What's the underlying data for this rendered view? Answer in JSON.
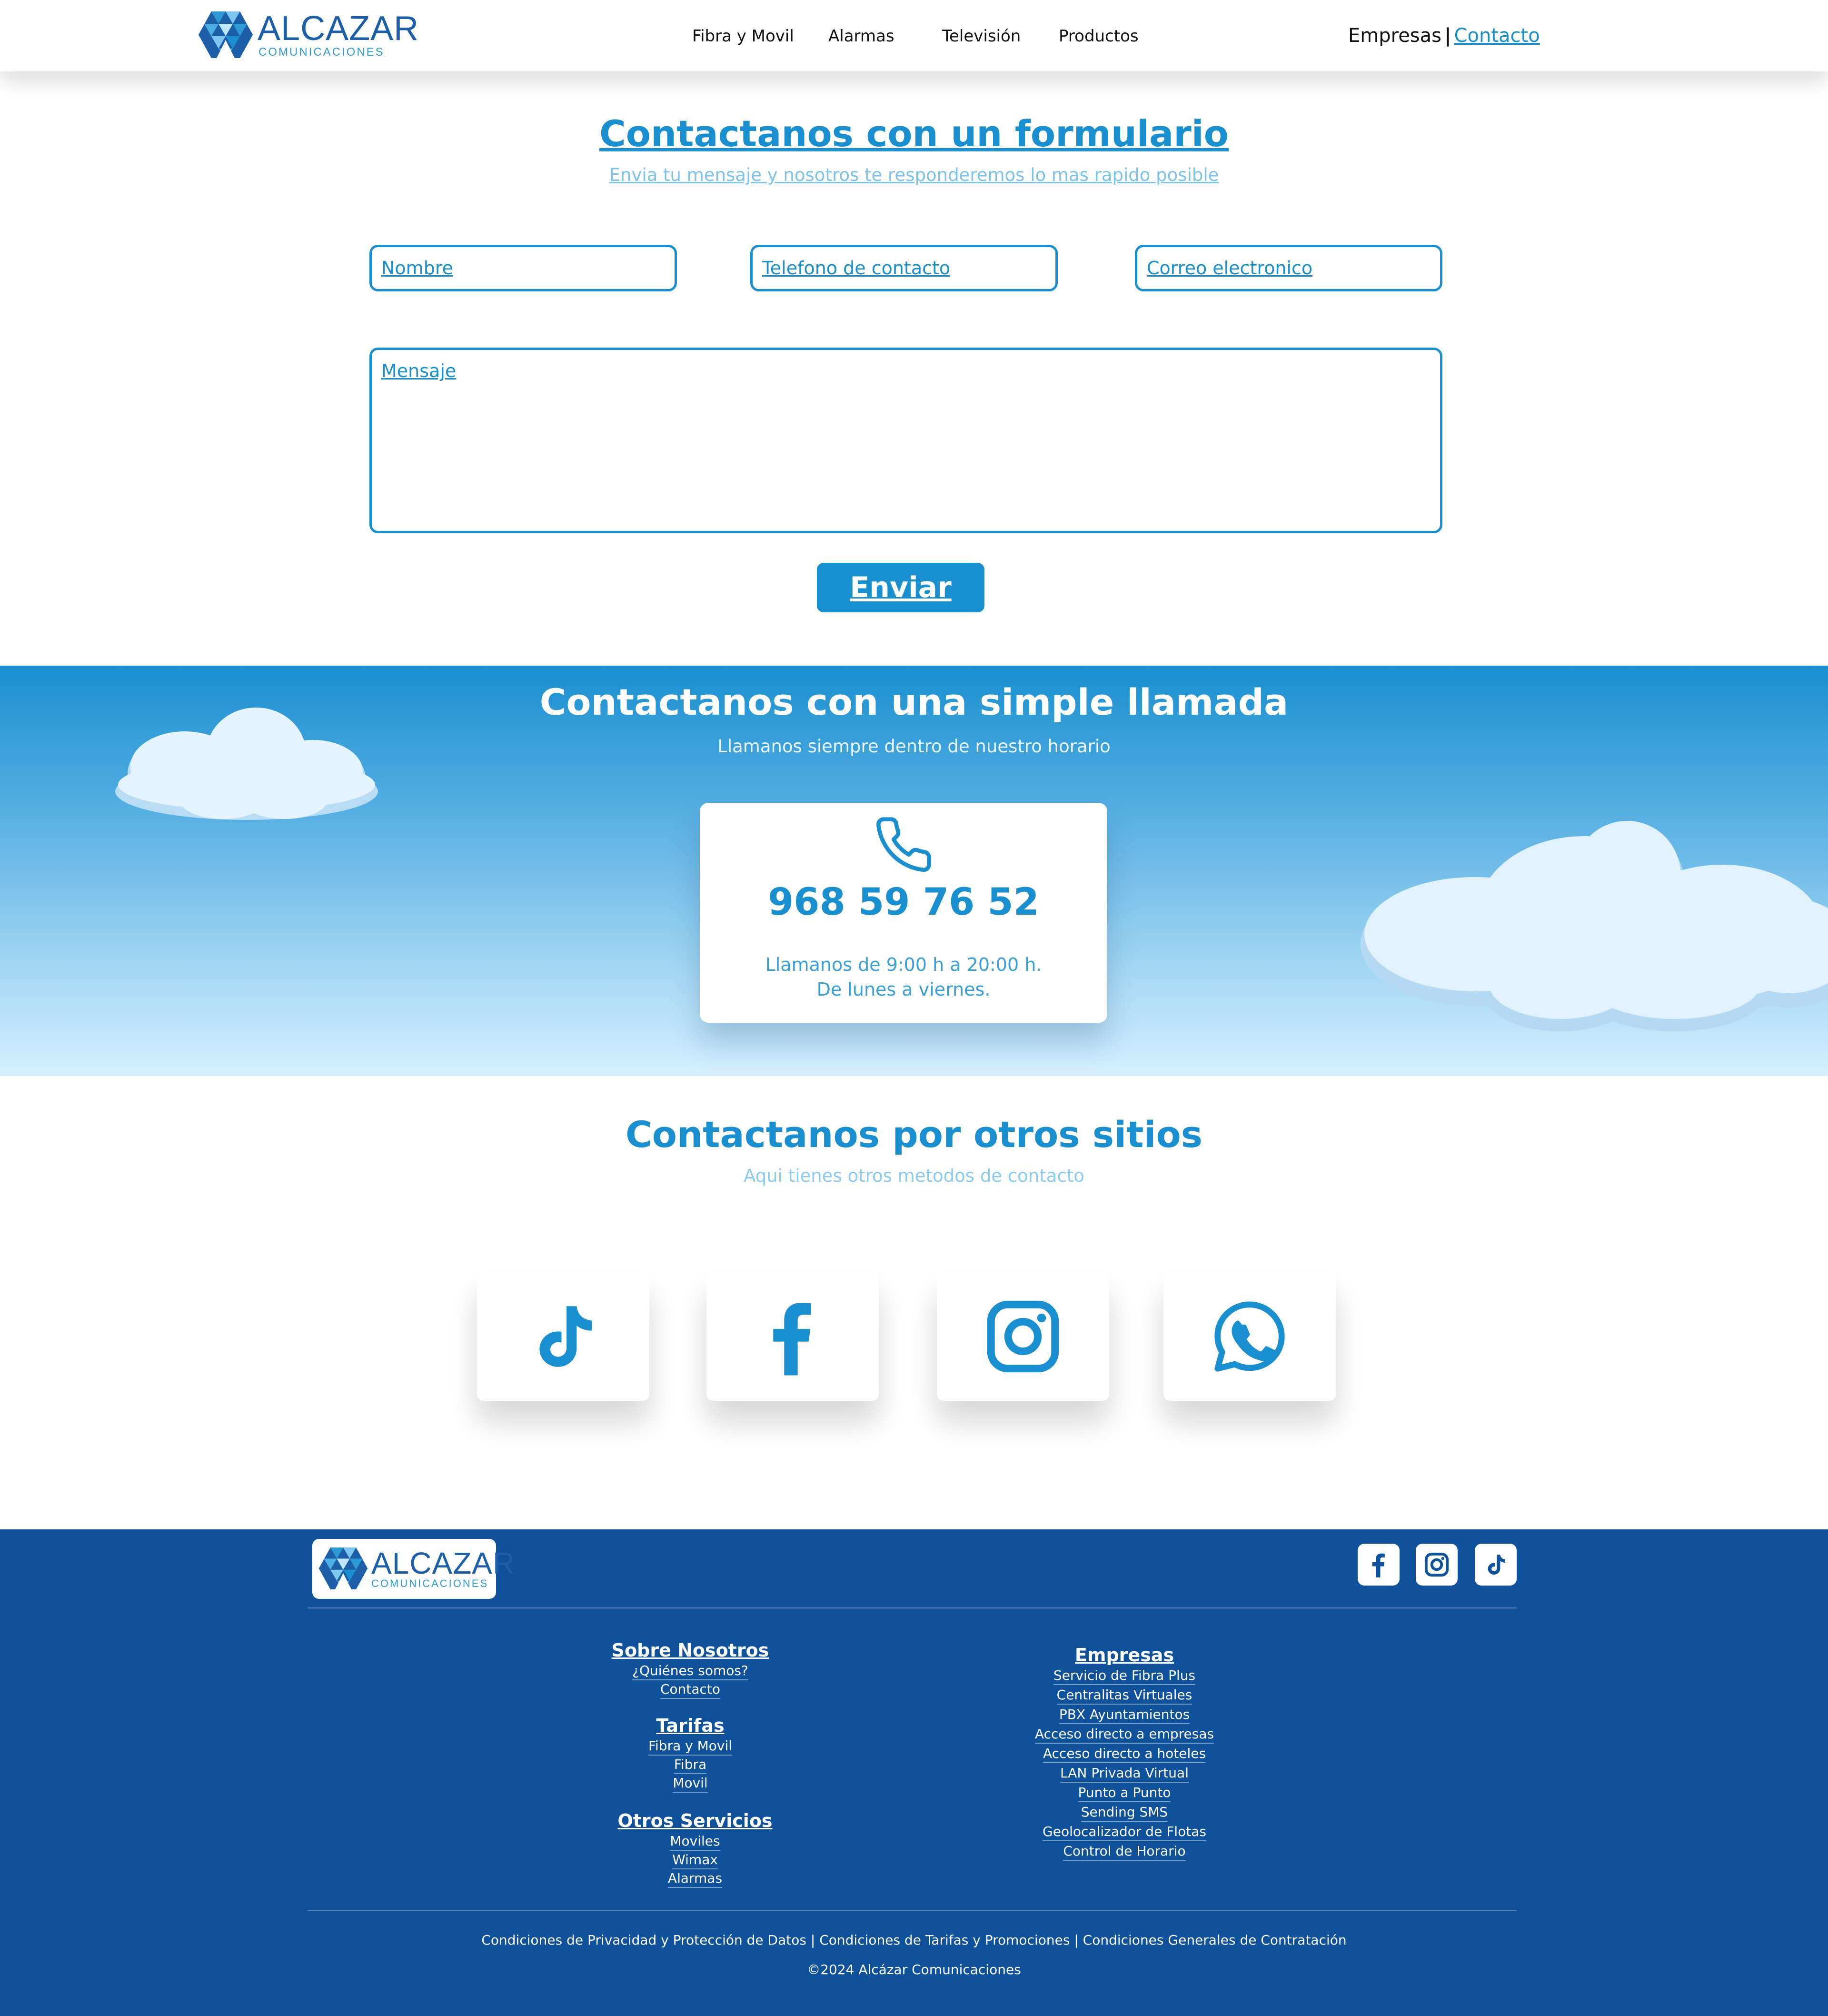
{
  "header": {
    "logo_word": "ALCAZAR",
    "logo_sub": "COMUNICACIONES",
    "nav": [
      "Fibra y Movil",
      "Alarmas",
      "Televisión",
      "Productos"
    ],
    "empresas": "Empresas",
    "separator": "|",
    "contacto": "Contacto"
  },
  "form_section": {
    "title": "Contactanos con un formulario",
    "subtitle": "Envia tu mensaje y nosotros te responderemos lo mas rapido posible",
    "fields": {
      "name_placeholder": "Nombre",
      "phone_placeholder": "Telefono de contacto",
      "email_placeholder": "Correo electronico",
      "message_placeholder": "Mensaje"
    },
    "submit_label": "Enviar"
  },
  "call_section": {
    "title": "Contactanos con una simple llamada",
    "subtitle": "Llamanos siempre dentro de nuestro horario",
    "phone": "968 59 76 52",
    "hours_line1": "Llamanos de 9:00 h a 20:00 h.",
    "hours_line2": "De lunes a viernes."
  },
  "other_section": {
    "title": "Contactanos por otros sitios",
    "subtitle": "Aqui tienes otros metodos de contacto",
    "icons": [
      "tiktok-icon",
      "facebook-icon",
      "instagram-icon",
      "whatsapp-icon"
    ]
  },
  "footer": {
    "logo_word": "ALCAZAR",
    "logo_sub": "COMUNICACIONES",
    "social_icons": [
      "facebook-icon",
      "instagram-icon",
      "tiktok-icon"
    ],
    "sobre": {
      "title": "Sobre Nosotros",
      "items": [
        "¿Quiénes somos?",
        "Contacto"
      ]
    },
    "tarifas": {
      "title": "Tarifas",
      "items": [
        "Fibra y Movil",
        "Fibra",
        "Movil"
      ]
    },
    "otros": {
      "title": "Otros Servicios",
      "items": [
        "Moviles",
        "Wimax",
        "Alarmas"
      ]
    },
    "empresas": {
      "title": "Empresas",
      "items": [
        "Servicio de Fibra Plus",
        "Centralitas Virtuales",
        "PBX Ayuntamientos",
        "Acceso directo a empresas",
        "Acceso directo a hoteles",
        "LAN Privada Virtual",
        "Punto a Punto",
        "Sending SMS",
        "Geolocalizador de Flotas",
        "Control de Horario"
      ]
    },
    "legal": "Condiciones de Privacidad y Protección de Datos | Condiciones de Tarifas y Promociones | Condiciones Generales de Contratación",
    "copyright": "©2024 Alcázar Comunicaciones"
  },
  "colors": {
    "primary": "#1a8fd0",
    "brand_dark": "#1c5fa8",
    "footer_bg": "#0f519b",
    "band_top": "#1a8fd0",
    "band_bottom": "#d6efff"
  }
}
